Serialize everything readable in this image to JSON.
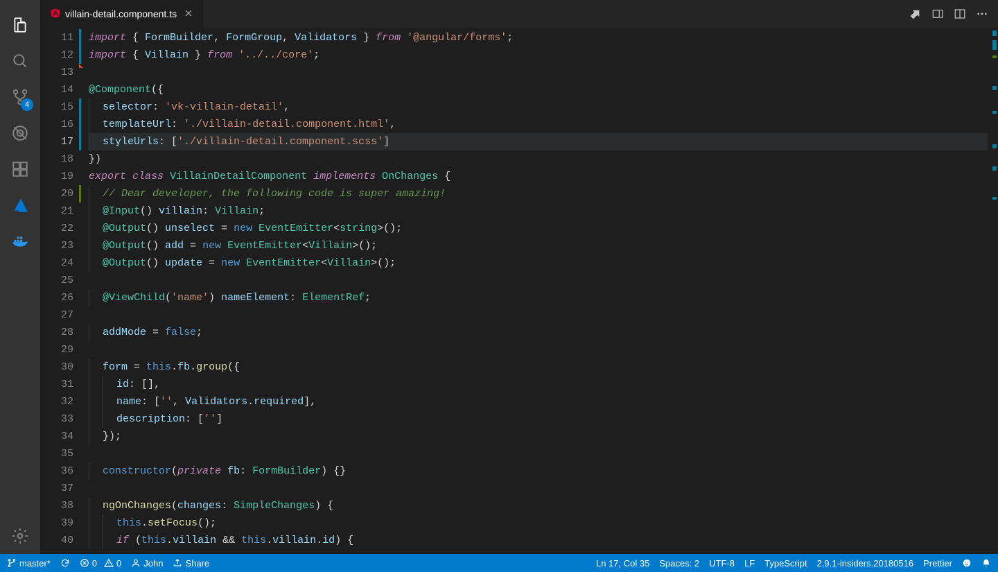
{
  "tab": {
    "filename": "villain-detail.component.ts"
  },
  "activity": {
    "scm_badge": "4"
  },
  "gutter_start": 11,
  "current_line_index": 6,
  "code_lines": [
    {
      "mod": "blue",
      "segs": [
        [
          "kw",
          "import"
        ],
        [
          "pun",
          " { "
        ],
        [
          "var",
          "FormBuilder"
        ],
        [
          "pun",
          ", "
        ],
        [
          "var",
          "FormGroup"
        ],
        [
          "pun",
          ", "
        ],
        [
          "var",
          "Validators"
        ],
        [
          "pun",
          " } "
        ],
        [
          "kw",
          "from"
        ],
        [
          "pun",
          " "
        ],
        [
          "str",
          "'@angular/forms'"
        ],
        [
          "pun",
          ";"
        ]
      ]
    },
    {
      "mod": "blue",
      "segs": [
        [
          "kw",
          "import"
        ],
        [
          "pun",
          " { "
        ],
        [
          "var",
          "Villain"
        ],
        [
          "pun",
          " } "
        ],
        [
          "kw",
          "from"
        ],
        [
          "pun",
          " "
        ],
        [
          "str",
          "'../../core'"
        ],
        [
          "pun",
          ";"
        ]
      ]
    },
    {
      "tri": true,
      "segs": []
    },
    {
      "segs": [
        [
          "dec",
          "@Component"
        ],
        [
          "pun",
          "({"
        ]
      ]
    },
    {
      "indent": 1,
      "mod": "blue",
      "segs": [
        [
          "var",
          "selector"
        ],
        [
          "pun",
          ": "
        ],
        [
          "str",
          "'vk-villain-detail'"
        ],
        [
          "pun",
          ","
        ]
      ]
    },
    {
      "indent": 1,
      "mod": "blue",
      "segs": [
        [
          "var",
          "templateUrl"
        ],
        [
          "pun",
          ": "
        ],
        [
          "str",
          "'./villain-detail.component.html'"
        ],
        [
          "pun",
          ","
        ]
      ]
    },
    {
      "indent": 1,
      "mod": "blue",
      "hl": true,
      "segs": [
        [
          "var",
          "styleUrls"
        ],
        [
          "pun",
          ": ["
        ],
        [
          "str",
          "'./villain-detail.component.scss'"
        ],
        [
          "pun",
          "]"
        ]
      ]
    },
    {
      "segs": [
        [
          "pun",
          "})"
        ]
      ]
    },
    {
      "segs": [
        [
          "kw",
          "export"
        ],
        [
          "pun",
          " "
        ],
        [
          "kw",
          "class"
        ],
        [
          "pun",
          " "
        ],
        [
          "cls",
          "VillainDetailComponent"
        ],
        [
          "pun",
          " "
        ],
        [
          "kw",
          "implements"
        ],
        [
          "pun",
          " "
        ],
        [
          "cls",
          "OnChanges"
        ],
        [
          "pun",
          " {"
        ]
      ]
    },
    {
      "indent": 1,
      "mod": "green",
      "segs": [
        [
          "cmt",
          "// Dear developer, the following code is super amazing!"
        ]
      ]
    },
    {
      "indent": 1,
      "segs": [
        [
          "dec",
          "@Input"
        ],
        [
          "pun",
          "() "
        ],
        [
          "var",
          "villain"
        ],
        [
          "pun",
          ": "
        ],
        [
          "cls",
          "Villain"
        ],
        [
          "pun",
          ";"
        ]
      ]
    },
    {
      "indent": 1,
      "segs": [
        [
          "dec",
          "@Output"
        ],
        [
          "pun",
          "() "
        ],
        [
          "var",
          "unselect"
        ],
        [
          "pun",
          " = "
        ],
        [
          "kw2",
          "new"
        ],
        [
          "pun",
          " "
        ],
        [
          "cls",
          "EventEmitter"
        ],
        [
          "pun",
          "<"
        ],
        [
          "cls",
          "string"
        ],
        [
          "pun",
          ">();"
        ]
      ]
    },
    {
      "indent": 1,
      "segs": [
        [
          "dec",
          "@Output"
        ],
        [
          "pun",
          "() "
        ],
        [
          "var",
          "add"
        ],
        [
          "pun",
          " = "
        ],
        [
          "kw2",
          "new"
        ],
        [
          "pun",
          " "
        ],
        [
          "cls",
          "EventEmitter"
        ],
        [
          "pun",
          "<"
        ],
        [
          "cls",
          "Villain"
        ],
        [
          "pun",
          ">();"
        ]
      ]
    },
    {
      "indent": 1,
      "segs": [
        [
          "dec",
          "@Output"
        ],
        [
          "pun",
          "() "
        ],
        [
          "var",
          "update"
        ],
        [
          "pun",
          " = "
        ],
        [
          "kw2",
          "new"
        ],
        [
          "pun",
          " "
        ],
        [
          "cls",
          "EventEmitter"
        ],
        [
          "pun",
          "<"
        ],
        [
          "cls",
          "Villain"
        ],
        [
          "pun",
          ">();"
        ]
      ]
    },
    {
      "segs": []
    },
    {
      "indent": 1,
      "segs": [
        [
          "dec",
          "@ViewChild"
        ],
        [
          "pun",
          "("
        ],
        [
          "str",
          "'name'"
        ],
        [
          "pun",
          ") "
        ],
        [
          "var",
          "nameElement"
        ],
        [
          "pun",
          ": "
        ],
        [
          "cls",
          "ElementRef"
        ],
        [
          "pun",
          ";"
        ]
      ]
    },
    {
      "segs": []
    },
    {
      "indent": 1,
      "segs": [
        [
          "var",
          "addMode"
        ],
        [
          "pun",
          " = "
        ],
        [
          "kw2",
          "false"
        ],
        [
          "pun",
          ";"
        ]
      ]
    },
    {
      "segs": []
    },
    {
      "indent": 1,
      "segs": [
        [
          "var",
          "form"
        ],
        [
          "pun",
          " = "
        ],
        [
          "kw2",
          "this"
        ],
        [
          "pun",
          "."
        ],
        [
          "var",
          "fb"
        ],
        [
          "pun",
          "."
        ],
        [
          "fn",
          "group"
        ],
        [
          "pun",
          "({"
        ]
      ]
    },
    {
      "indent": 2,
      "segs": [
        [
          "var",
          "id"
        ],
        [
          "pun",
          ": [],"
        ]
      ]
    },
    {
      "indent": 2,
      "segs": [
        [
          "var",
          "name"
        ],
        [
          "pun",
          ": ["
        ],
        [
          "str",
          "''"
        ],
        [
          "pun",
          ", "
        ],
        [
          "var",
          "Validators"
        ],
        [
          "pun",
          "."
        ],
        [
          "var",
          "required"
        ],
        [
          "pun",
          "],"
        ]
      ]
    },
    {
      "indent": 2,
      "segs": [
        [
          "var",
          "description"
        ],
        [
          "pun",
          ": ["
        ],
        [
          "str",
          "''"
        ],
        [
          "pun",
          "]"
        ]
      ]
    },
    {
      "indent": 1,
      "segs": [
        [
          "pun",
          "});"
        ]
      ]
    },
    {
      "segs": []
    },
    {
      "indent": 1,
      "segs": [
        [
          "kw2",
          "constructor"
        ],
        [
          "pun",
          "("
        ],
        [
          "kw",
          "private"
        ],
        [
          "pun",
          " "
        ],
        [
          "var",
          "fb"
        ],
        [
          "pun",
          ": "
        ],
        [
          "cls",
          "FormBuilder"
        ],
        [
          "pun",
          ") {}"
        ]
      ]
    },
    {
      "segs": []
    },
    {
      "indent": 1,
      "segs": [
        [
          "fn",
          "ngOnChanges"
        ],
        [
          "pun",
          "("
        ],
        [
          "var",
          "changes"
        ],
        [
          "pun",
          ": "
        ],
        [
          "cls",
          "SimpleChanges"
        ],
        [
          "pun",
          ") {"
        ]
      ]
    },
    {
      "indent": 2,
      "segs": [
        [
          "kw2",
          "this"
        ],
        [
          "pun",
          "."
        ],
        [
          "fn",
          "setFocus"
        ],
        [
          "pun",
          "();"
        ]
      ]
    },
    {
      "indent": 2,
      "segs": [
        [
          "kw",
          "if"
        ],
        [
          "pun",
          " ("
        ],
        [
          "kw2",
          "this"
        ],
        [
          "pun",
          "."
        ],
        [
          "var",
          "villain"
        ],
        [
          "pun",
          " && "
        ],
        [
          "kw2",
          "this"
        ],
        [
          "pun",
          "."
        ],
        [
          "var",
          "villain"
        ],
        [
          "pun",
          "."
        ],
        [
          "var",
          "id"
        ],
        [
          "pun",
          ") {"
        ]
      ]
    }
  ],
  "status": {
    "branch": "master*",
    "errors": "0",
    "warnings": "0",
    "user": "John",
    "share": "Share",
    "position": "Ln 17, Col 35",
    "spaces": "Spaces: 2",
    "encoding": "UTF-8",
    "eol": "LF",
    "language": "TypeScript",
    "version": "2.9.1-insiders.20180516",
    "formatter": "Prettier"
  }
}
